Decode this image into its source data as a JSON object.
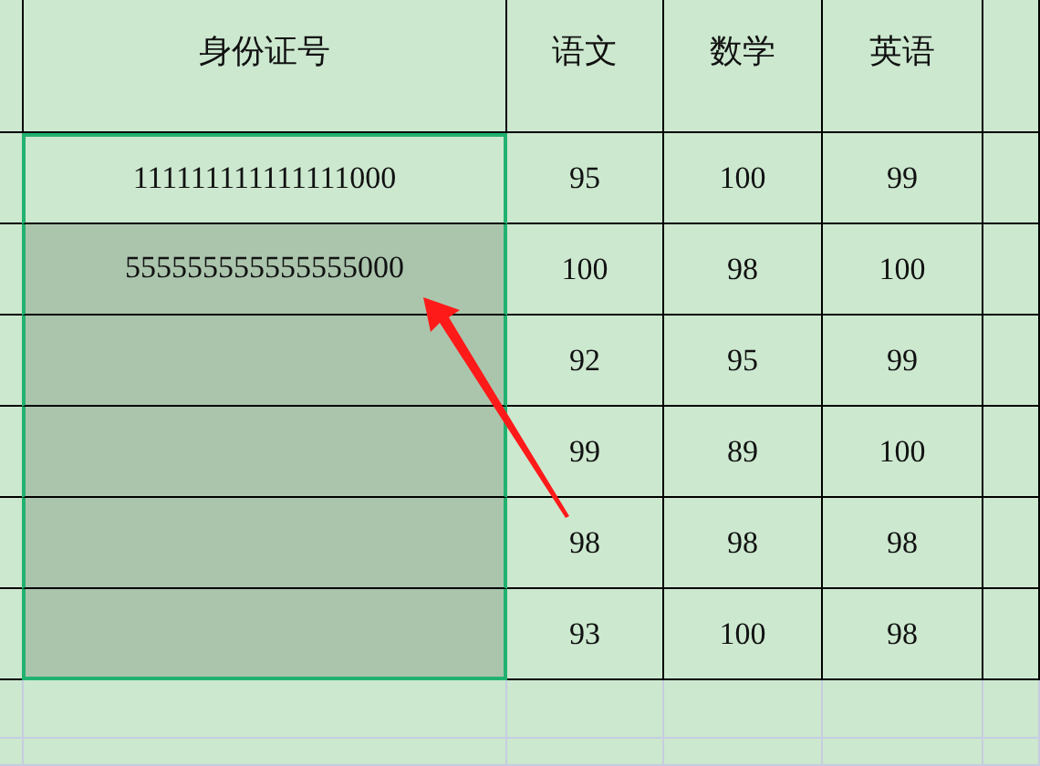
{
  "headers": [
    "身份证号",
    "语文",
    "数学",
    "英语"
  ],
  "rows": [
    {
      "id": "111111111111111000",
      "scores": [
        "95",
        "100",
        "99"
      ],
      "selected": true,
      "active": true
    },
    {
      "id": "555555555555555000",
      "scores": [
        "100",
        "98",
        "100"
      ],
      "selected": true,
      "active": false
    },
    {
      "id": "",
      "scores": [
        "92",
        "95",
        "99"
      ],
      "selected": true,
      "active": false
    },
    {
      "id": "",
      "scores": [
        "99",
        "89",
        "100"
      ],
      "selected": true,
      "active": false
    },
    {
      "id": "",
      "scores": [
        "98",
        "98",
        "98"
      ],
      "selected": true,
      "active": false
    },
    {
      "id": "",
      "scores": [
        "93",
        "100",
        "98"
      ],
      "selected": true,
      "active": false
    }
  ]
}
